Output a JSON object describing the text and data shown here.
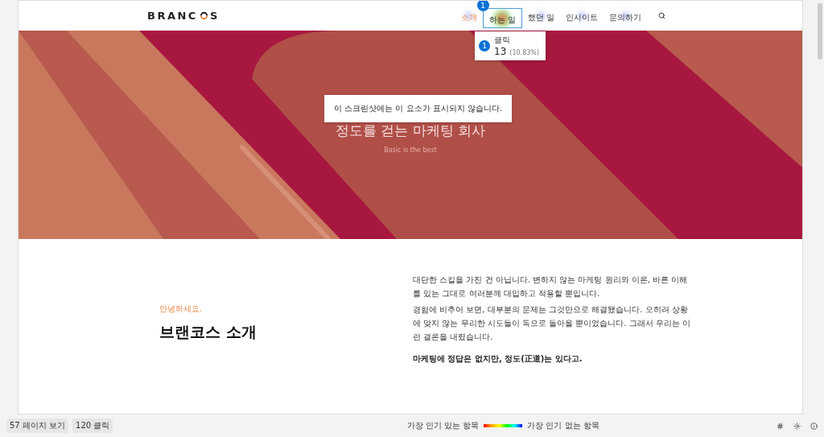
{
  "logo": {
    "left": "BRANC",
    "right": "S"
  },
  "nav": [
    {
      "label": "소개",
      "selected": true
    },
    {
      "label": "하는 일",
      "selected": false
    },
    {
      "label": "했던 일",
      "selected": false
    },
    {
      "label": "인사이트",
      "selected": false
    },
    {
      "label": "문의하기",
      "selected": false
    }
  ],
  "click_badge": "1",
  "tooltip": {
    "badge": "1",
    "label": "클릭",
    "count": "13",
    "percent": "(10.83%)"
  },
  "hero": {
    "title": "정도를 걷는 마케팅 회사",
    "subtitle": "Basic is the best",
    "notice": "이 스크린샷에는 이 요소가 표시되지 않습니다."
  },
  "intro": {
    "eyebrow": "안녕하세요.",
    "heading": "브랜코스 소개",
    "paragraphs": [
      "대단한 스킬을 가진 건 아닙니다. 변하지 않는 마케팅 원리와 이론, 바른 이해를 있는 그대로 여러분께 대입하고 적용할 뿐입니다.",
      "경험에 비추어 보면, 대부분의 문제는 그것만으로 해결됐습니다. 오히려 상황에 맞지 않는 무리한 시도들이 독으로 돌아올 뿐이었습니다. 그래서 우리는 이런 결론을 내렸습니다."
    ],
    "conclusion": "마케팅에 정답은 없지만, 정도(正道)는 있다고."
  },
  "footer": {
    "pageviews": "57 페이지 보기",
    "clicks": "120 클릭",
    "legend_most": "가장 인기 있는 항목",
    "legend_least": "가장 인기 없는 항목"
  }
}
